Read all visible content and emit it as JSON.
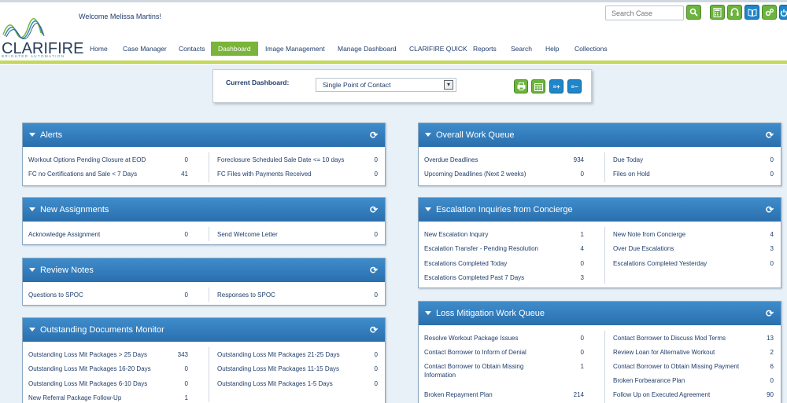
{
  "header": {
    "welcome": "Welcome Melissa Martins!",
    "logo_text": "CLARIFIRE",
    "logo_sub": "BRIGHTER AUTOMATION",
    "search_placeholder": "Search Case"
  },
  "nav": [
    "Home",
    "Case Manager",
    "Contacts",
    "Dashboard",
    "Image Management",
    "Manage Dashboard",
    "CLARIFIRE QUICK",
    "Reports",
    "Search",
    "Help",
    "Collections"
  ],
  "dashboard": {
    "label": "Current Dashboard:",
    "selected": "Single Point of Contact"
  },
  "panels": {
    "alerts": {
      "title": "Alerts",
      "left": [
        {
          "label": "Workout Options Pending Closure at EOD",
          "value": "0"
        },
        {
          "label": "FC no Certifications and Sale < 7 Days",
          "value": "41"
        }
      ],
      "right": [
        {
          "label": "Foreclosure Scheduled Sale Date <= 10 days",
          "value": "0"
        },
        {
          "label": "FC Files with Payments Received",
          "value": "0"
        }
      ]
    },
    "new_assignments": {
      "title": "New Assignments",
      "left": [
        {
          "label": "Acknowledge Assignment",
          "value": "0"
        }
      ],
      "right": [
        {
          "label": "Send Welcome Letter",
          "value": "0"
        }
      ]
    },
    "review_notes": {
      "title": "Review Notes",
      "left": [
        {
          "label": "Questions to SPOC",
          "value": "0"
        }
      ],
      "right": [
        {
          "label": "Responses to SPOC",
          "value": "0"
        }
      ]
    },
    "outstanding": {
      "title": "Outstanding Documents Monitor",
      "left": [
        {
          "label": "Outstanding Loss Mit Packages > 25 Days",
          "value": "343"
        },
        {
          "label": "Outstanding Loss Mit Packages 16-20 Days",
          "value": "0"
        },
        {
          "label": "Outstanding Loss Mit Packages 6-10 Days",
          "value": "0"
        },
        {
          "label": "New Referral Package Follow-Up",
          "value": "1"
        }
      ],
      "right": [
        {
          "label": "Outstanding Loss Mit Packages 21-25 Days",
          "value": "0"
        },
        {
          "label": "Outstanding Loss Mit Packages 11-15 Days",
          "value": "0"
        },
        {
          "label": "Outstanding Loss Mit Packages 1-5 Days",
          "value": "0"
        }
      ]
    },
    "overall": {
      "title": "Overall Work Queue",
      "left": [
        {
          "label": "Overdue Deadlines",
          "value": "934"
        },
        {
          "label": "Upcoming Deadlines (Next 2 weeks)",
          "value": "0"
        }
      ],
      "right": [
        {
          "label": "Due Today",
          "value": "0"
        },
        {
          "label": "Files on Hold",
          "value": "0"
        }
      ]
    },
    "escalation": {
      "title": "Escalation Inquiries from Concierge",
      "left": [
        {
          "label": "New Escalation Inquiry",
          "value": "1"
        },
        {
          "label": "Escalation Transfer - Pending Resolution",
          "value": "4"
        },
        {
          "label": "Escalations Completed Today",
          "value": "0"
        },
        {
          "label": "Escalations Completed Past 7 Days",
          "value": "3"
        }
      ],
      "right": [
        {
          "label": "New Note from Concierge",
          "value": "4"
        },
        {
          "label": "Over Due Escalations",
          "value": "3"
        },
        {
          "label": "Escalations Completed Yesterday",
          "value": "0"
        }
      ]
    },
    "loss_mit": {
      "title": "Loss Mitigation Work Queue",
      "left": [
        {
          "label": "Resolve Workout Package Issues",
          "value": "0"
        },
        {
          "label": "Contact Borrower to Inform of Denial",
          "value": "0"
        },
        {
          "label": "Contact Borrower to Obtain Missing",
          "label2": "Information",
          "value": "1"
        },
        {
          "label": "Broken Repayment Plan",
          "value": "214"
        }
      ],
      "right": [
        {
          "label": "Contact Borrower to Discuss Mod Terms",
          "value": "13"
        },
        {
          "label": "Review Loan for Alternative Workout",
          "value": "2"
        },
        {
          "label": "Contact Borrower to Obtain Missing Payment",
          "value": "6"
        },
        {
          "label": "Broken Forbearance Plan",
          "value": "0"
        },
        {
          "label": "Follow Up on Executed Agreement",
          "value": "90"
        }
      ]
    }
  }
}
